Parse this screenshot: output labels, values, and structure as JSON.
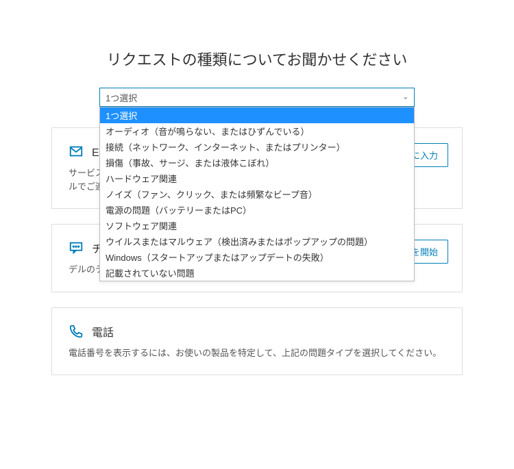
{
  "page_title": "リクエストの種類についてお聞かせください",
  "select": {
    "placeholder": "1つ選択",
    "options": [
      "1つ選択",
      "オーディオ（音が鳴らない、またはひずんでいる）",
      "接続（ネットワーク、インターネット、またはプリンター）",
      "損傷（事故、サージ、または液体こぼれ）",
      "ハードウェア関連",
      "ノイズ（ファン、クリック、または頻繁なビープ音）",
      "電源の問題（バッテリーまたはPC）",
      "ソフトウェア関連",
      "ウイルスまたはマルウェア（検出済みまたはポップアップの問題）",
      "Windows（スタートアップまたはアップデートの失敗）",
      "記載されていない問題"
    ],
    "selected_index": 0
  },
  "cards": {
    "email": {
      "title": "Eメー",
      "desc_line1": "サービス リク",
      "desc_line2": "ルでご連絡差し上げます。",
      "button_partial": "ームに入力"
    },
    "chat": {
      "title": "チャット",
      "desc": "デルのテクニカル エクスパートとチャット。",
      "button": "チャットを開始"
    },
    "phone": {
      "title": "電話",
      "desc": "電話番号を表示するには、お使いの製品を特定して、上記の問題タイプを選択してください。"
    }
  }
}
